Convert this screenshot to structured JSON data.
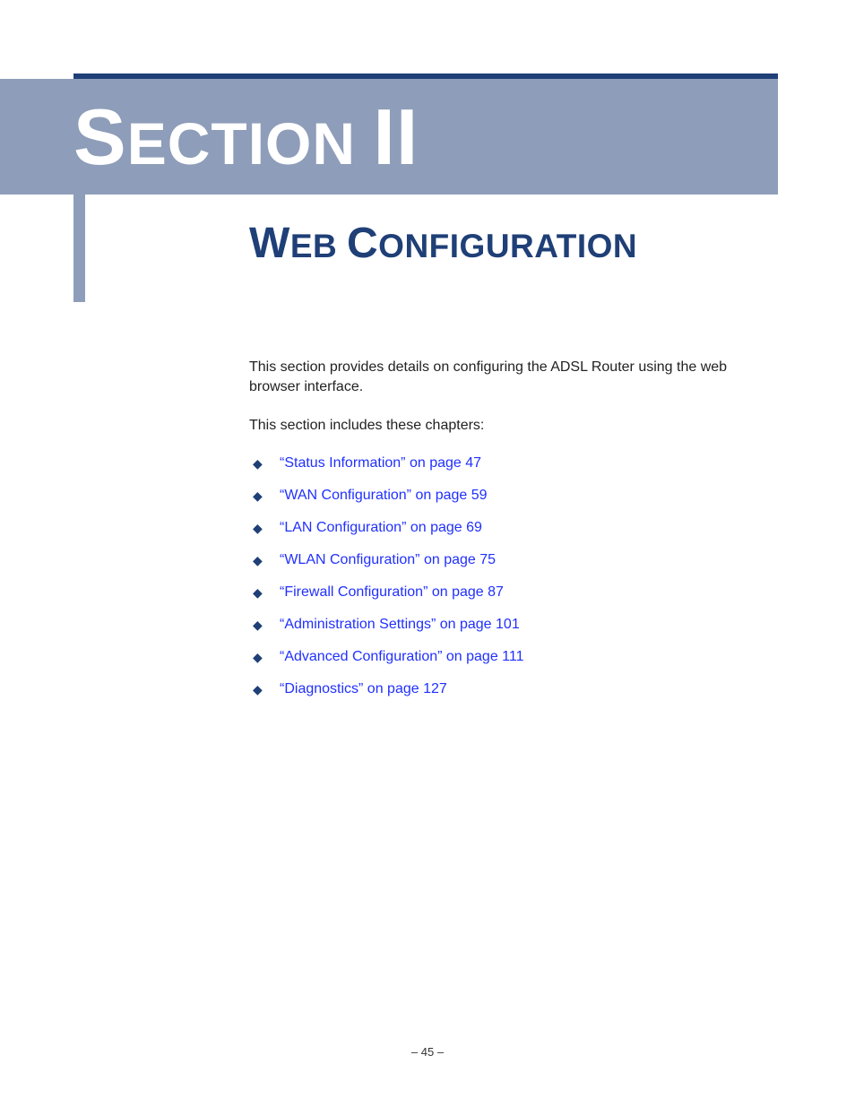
{
  "banner": {
    "word1_first": "S",
    "word1_rest": "ECTION",
    "space": " ",
    "word2": "II"
  },
  "title": {
    "w1_first": "W",
    "w1_rest": "EB",
    "space": " ",
    "w2_first": "C",
    "w2_rest": "ONFIGURATION"
  },
  "intro1": "This section provides details on configuring the ADSL Router using the web browser interface.",
  "intro2": "This section includes these chapters:",
  "chapters": [
    "“Status Information” on page 47",
    "“WAN Configuration” on page 59",
    "“LAN Configuration” on page 69",
    "“WLAN Configuration” on page 75",
    "“Firewall Configuration” on page 87",
    "“Administration Settings” on page 101",
    "“Advanced Configuration” on page 111",
    "“Diagnostics” on page 127"
  ],
  "footer": "–  45  –"
}
